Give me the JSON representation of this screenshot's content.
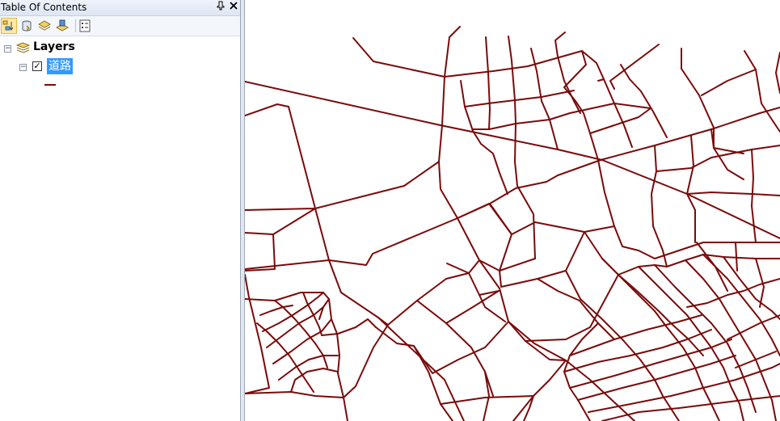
{
  "toc": {
    "title": "Table Of Contents",
    "pin_glyph": "📌",
    "close_glyph": "✕",
    "toolbar": {
      "buttons": [
        {
          "name": "list-by-drawing-order-icon",
          "active": true
        },
        {
          "name": "list-by-source-icon",
          "active": false
        },
        {
          "name": "list-by-visibility-icon",
          "active": false
        },
        {
          "name": "list-by-selection-icon",
          "active": false
        },
        {
          "name": "options-icon",
          "active": false
        }
      ]
    },
    "tree": {
      "root_label": "Layers",
      "layer": {
        "name": "道路",
        "checked": true,
        "symbol_color": "#7a0a0a"
      }
    }
  },
  "map": {
    "line_color": "#7a0a0a",
    "background": "#ffffff"
  }
}
